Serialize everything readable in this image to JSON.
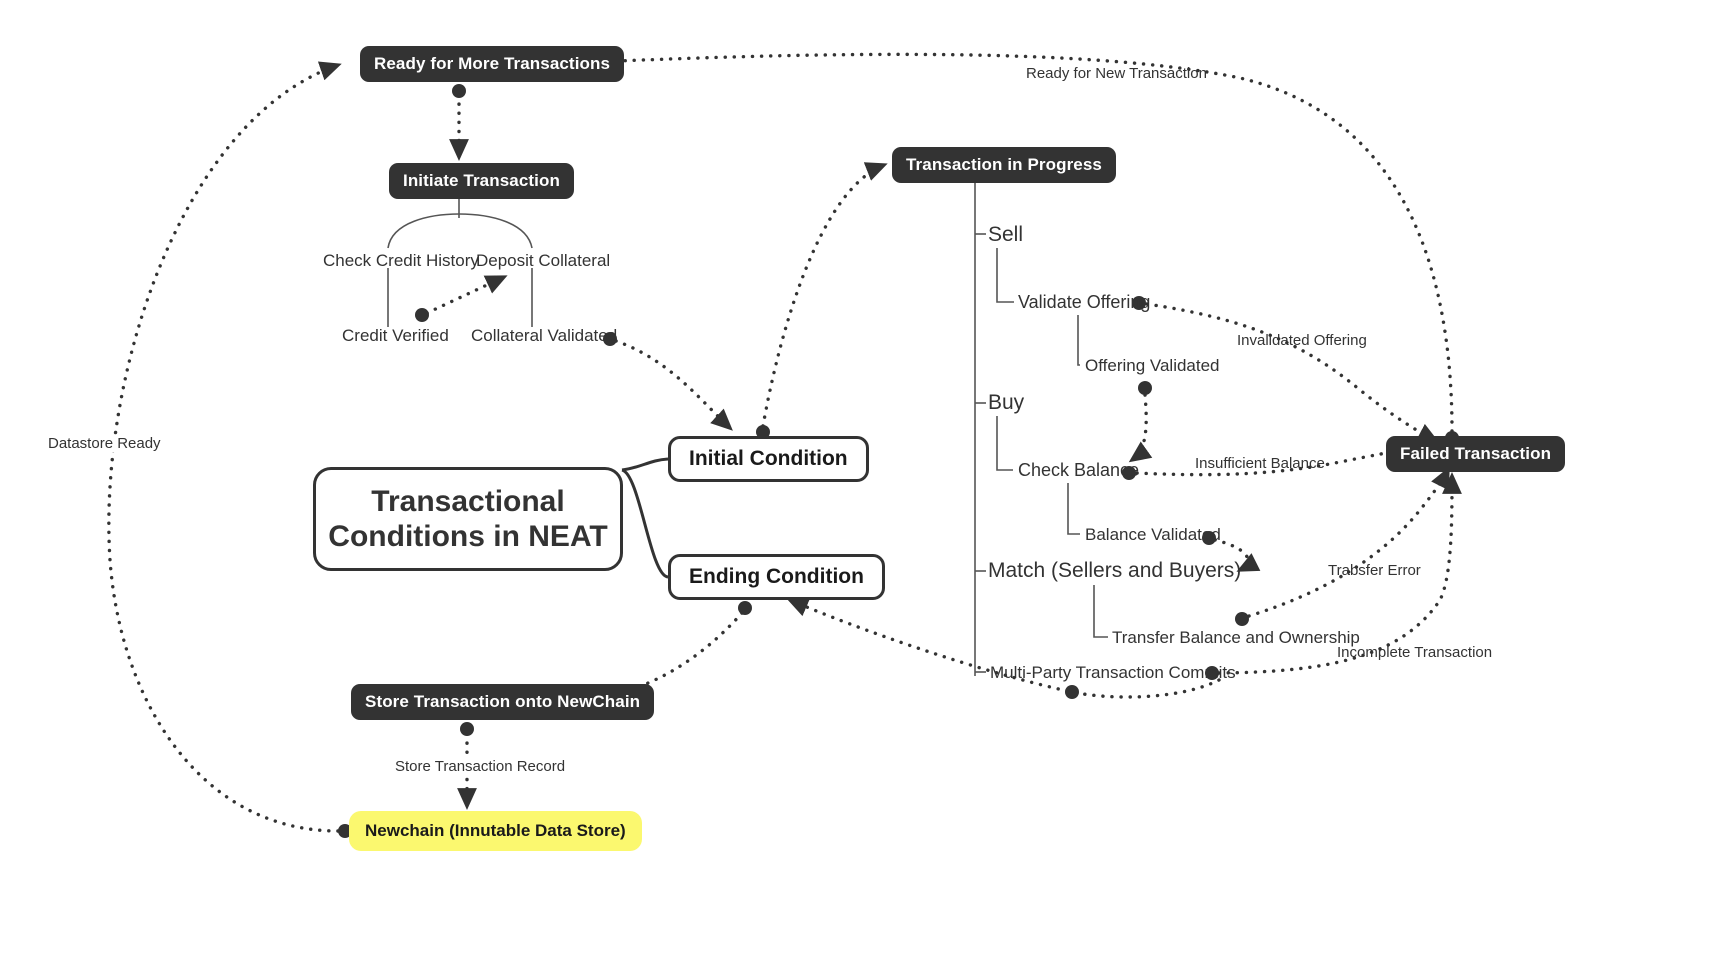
{
  "diagram": {
    "title": "Transactional Conditions in NEAT",
    "root": {
      "line1": "Transactional",
      "line2": "Conditions in NEAT"
    },
    "nodes": {
      "ready_more": "Ready for More Transactions",
      "initiate": "Initiate Transaction",
      "check_credit": "Check Credit History",
      "deposit_collateral": "Deposit Collateral",
      "credit_verified": "Credit Verified",
      "collateral_validated": "Collateral Validated",
      "initial_condition": "Initial Condition",
      "ending_condition": "Ending Condition",
      "transaction_in_progress": "Transaction in Progress",
      "sell": "Sell",
      "validate_offering": "Validate Offering",
      "offering_validated": "Offering Validated",
      "buy": "Buy",
      "check_balance": "Check Balance",
      "balance_validated": "Balance Validated",
      "match": "Match (Sellers and Buyers)",
      "transfer_balance": "Transfer Balance and Ownership",
      "multi_party": "Multi-Party Transaction Commits",
      "failed_transaction": "Failed Transaction",
      "store_transaction": "Store Transaction onto NewChain",
      "newchain": "Newchain (Innutable Data Store)"
    },
    "edge_labels": {
      "ready_new_transaction": "Ready for New Transaction",
      "invalidated_offering": "Invalidated Offering",
      "insufficient_balance": "Insufficient Balance",
      "transfer_error": "Trabsfer Error",
      "incomplete_transaction": "Incomplete Transaction",
      "store_transaction_record": "Store Transaction Record",
      "datastore_ready": "Datastore Ready"
    },
    "colors": {
      "dark_node": "#333333",
      "highlight_node": "#fbf86f",
      "text": "#333333",
      "canvas": "#ffffff"
    }
  }
}
